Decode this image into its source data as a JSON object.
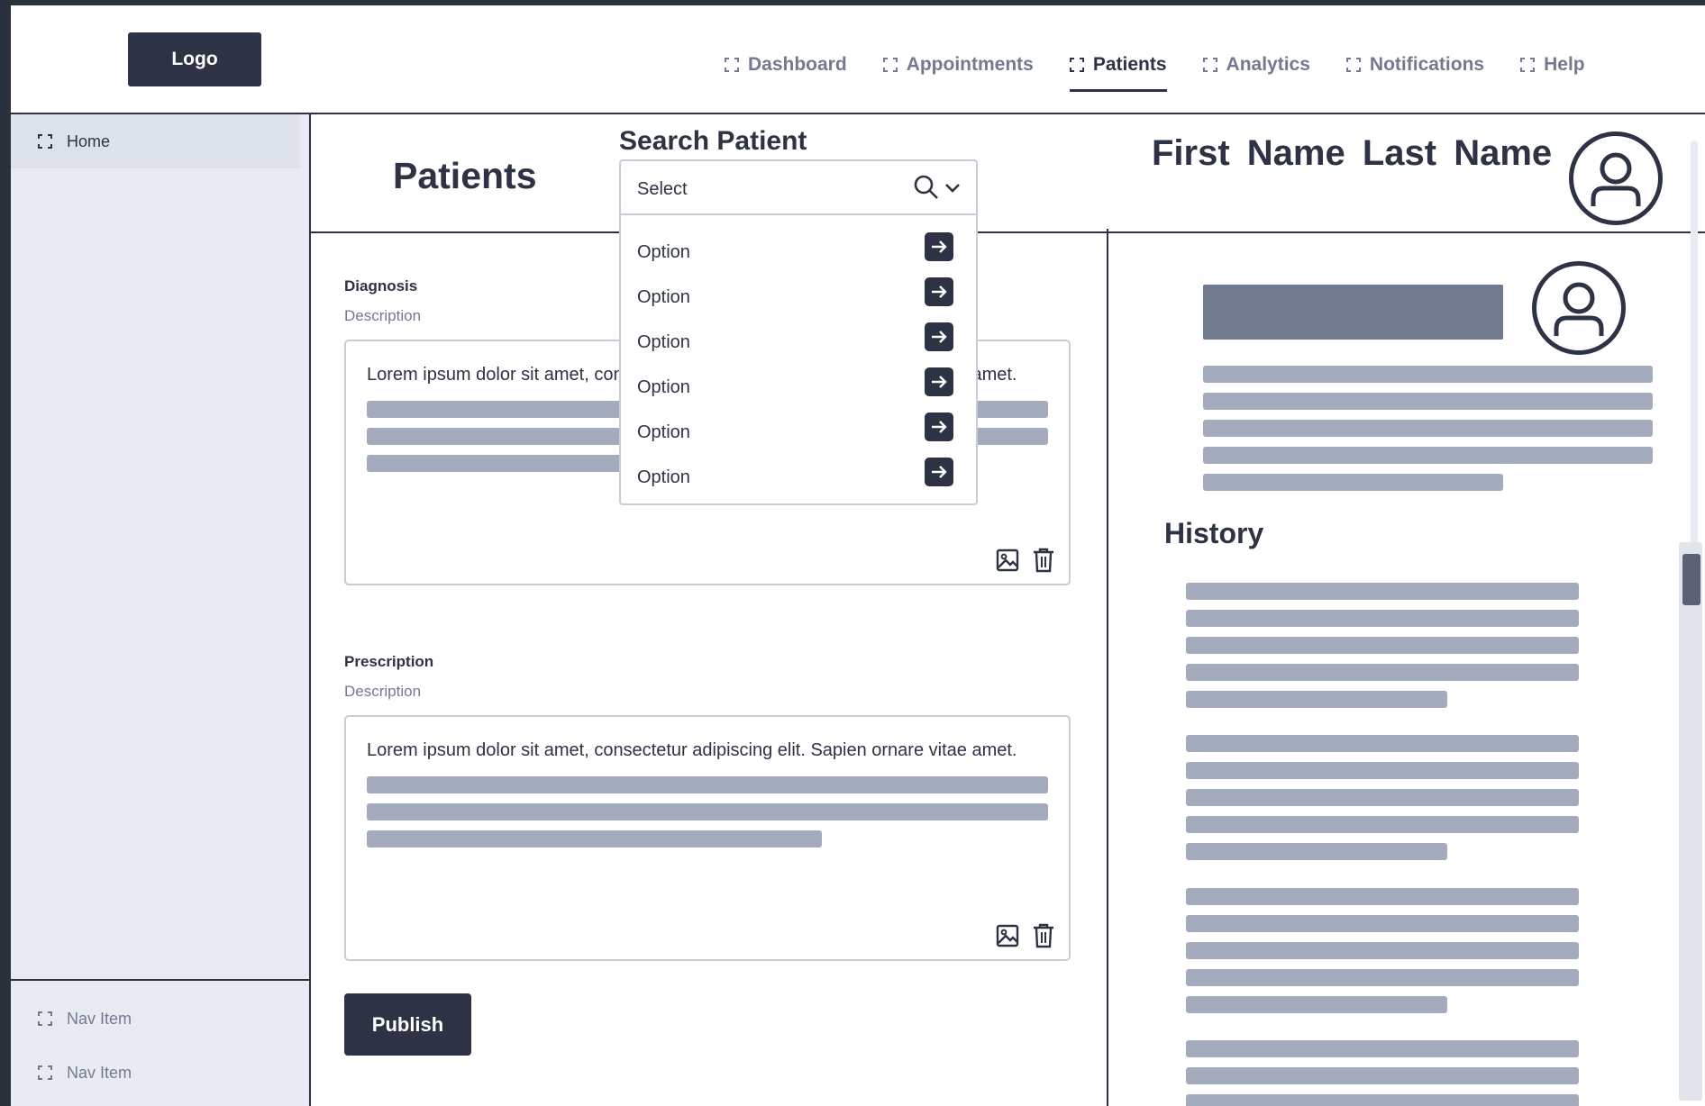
{
  "header": {
    "logo": "Logo",
    "nav": [
      {
        "label": "Dashboard",
        "active": false
      },
      {
        "label": "Appointments",
        "active": false
      },
      {
        "label": "Patients",
        "active": true
      },
      {
        "label": "Analytics",
        "active": false
      },
      {
        "label": "Notifications",
        "active": false
      },
      {
        "label": "Help",
        "active": false
      }
    ]
  },
  "sidebar": {
    "top_items": [
      {
        "label": "Home"
      }
    ],
    "bottom_items": [
      {
        "label": "Nav Item"
      },
      {
        "label": "Nav Item"
      }
    ]
  },
  "main": {
    "page_title": "Patients",
    "search": {
      "label": "Search Patient",
      "selected": "Select",
      "options": [
        "Option",
        "Option",
        "Option",
        "Option",
        "Option",
        "Option"
      ]
    },
    "patient_name": "First Name  Last Name",
    "diagnosis": {
      "label": "Diagnosis",
      "description": "Description",
      "text": "Lorem ipsum dolor sit amet, consectetur adipiscing elit. Sapien ornare vitae amet."
    },
    "prescription": {
      "label": "Prescription",
      "description": "Description",
      "text": "Lorem ipsum dolor sit amet, consectetur adipiscing elit. Sapien ornare vitae amet."
    },
    "publish_label": "Publish"
  },
  "right_panel": {
    "history_title": "History"
  },
  "colors": {
    "primary": "#2d3344",
    "muted": "#727a90",
    "placeholder_bar": "#a3abbd",
    "sidebar_bg": "#e8ebf1"
  }
}
